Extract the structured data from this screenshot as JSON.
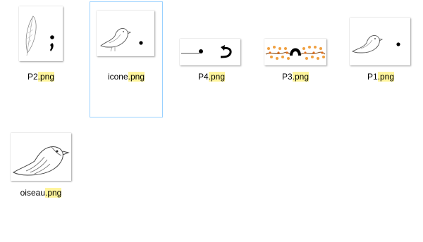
{
  "files": [
    {
      "base": "P2",
      "ext": ".png",
      "icon": "feather-semicolon-icon",
      "selected": false
    },
    {
      "base": "icone",
      "ext": ".png",
      "icon": "bird-period-icon",
      "selected": true
    },
    {
      "base": "P4",
      "ext": ".png",
      "icon": "line-dot-arrow-icon",
      "selected": false
    },
    {
      "base": "P3",
      "ext": ".png",
      "icon": "branches-arc-icon",
      "selected": false
    },
    {
      "base": "P1",
      "ext": ".png",
      "icon": "bird-period-icon",
      "selected": false
    },
    {
      "base": "oiseau",
      "ext": ".png",
      "icon": "bird-icon",
      "selected": false
    }
  ],
  "colors": {
    "selection_border": "#99d1ff",
    "extension_highlight": "#fff59d"
  }
}
